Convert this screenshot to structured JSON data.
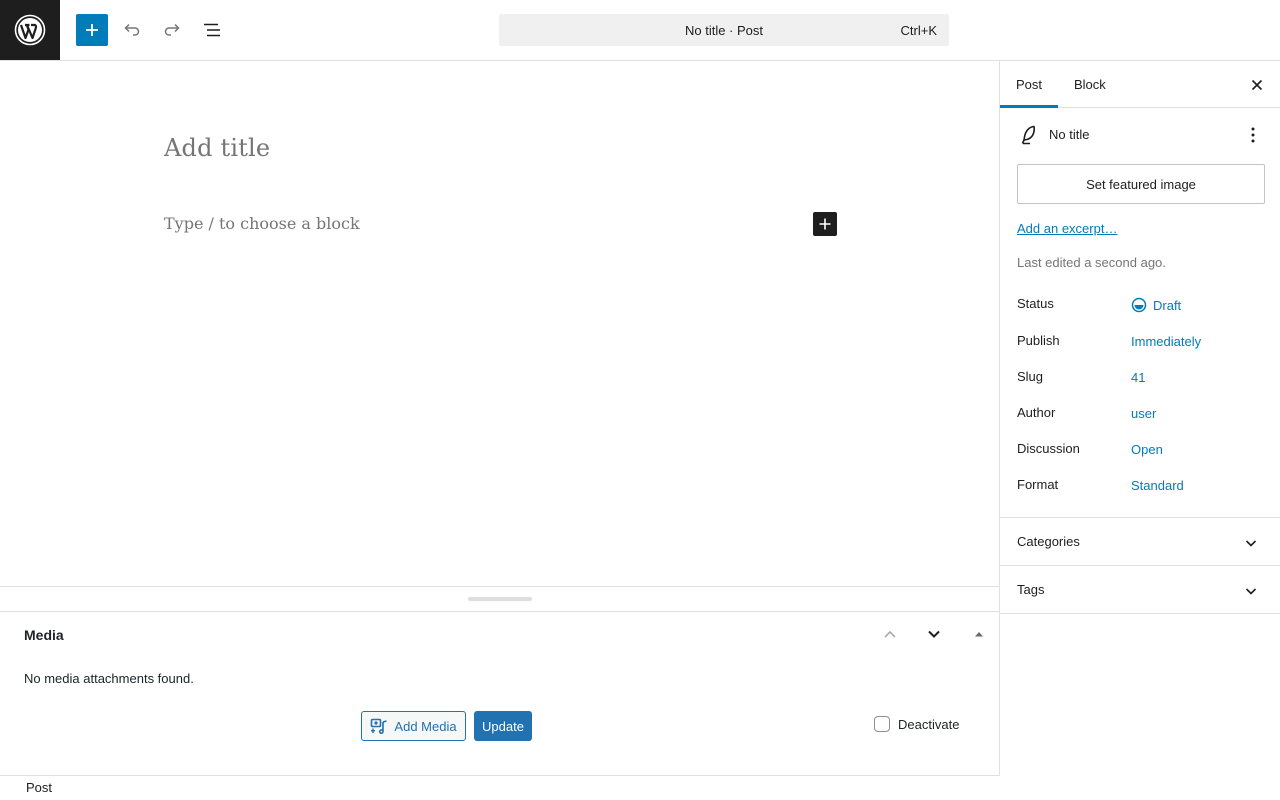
{
  "header": {
    "command_bar_title": "No title · Post",
    "command_bar_shortcut": "Ctrl+K"
  },
  "editor": {
    "title_placeholder": "Add title",
    "block_placeholder": "Type / to choose a block"
  },
  "metabox": {
    "title": "Media",
    "empty_text": "No media attachments found.",
    "add_media_label": "Add Media",
    "update_label": "Update",
    "deactivate_label": "Deactivate",
    "deactivate_checked": false
  },
  "footer": {
    "breadcrumb": "Post"
  },
  "sidebar": {
    "tabs": [
      {
        "label": "Post",
        "active": true
      },
      {
        "label": "Block",
        "active": false
      }
    ],
    "post_title": "No title",
    "featured_image_label": "Set featured image",
    "excerpt_link": "Add an excerpt…",
    "last_edited": "Last edited a second ago.",
    "meta": [
      {
        "key": "Status",
        "value": "Draft",
        "icon": "draft-status-icon"
      },
      {
        "key": "Publish",
        "value": "Immediately"
      },
      {
        "key": "Slug",
        "value": "41"
      },
      {
        "key": "Author",
        "value": "user"
      },
      {
        "key": "Discussion",
        "value": "Open"
      },
      {
        "key": "Format",
        "value": "Standard"
      }
    ],
    "panels": [
      {
        "label": "Categories",
        "expanded": false
      },
      {
        "label": "Tags",
        "expanded": false
      }
    ]
  },
  "colors": {
    "accent": "#007cba",
    "admin_blue": "#2271b1",
    "dark": "#1e1e1e",
    "muted": "#757575",
    "border": "#e0e0e0"
  },
  "icons": [
    "wordpress-logo-icon",
    "plus-icon",
    "undo-icon",
    "redo-icon",
    "document-overview-icon",
    "close-icon",
    "feather-post-icon",
    "more-vertical-icon",
    "draft-status-icon",
    "chevron-down-icon",
    "chevron-up-icon",
    "arrow-up-icon",
    "add-media-icon"
  ]
}
